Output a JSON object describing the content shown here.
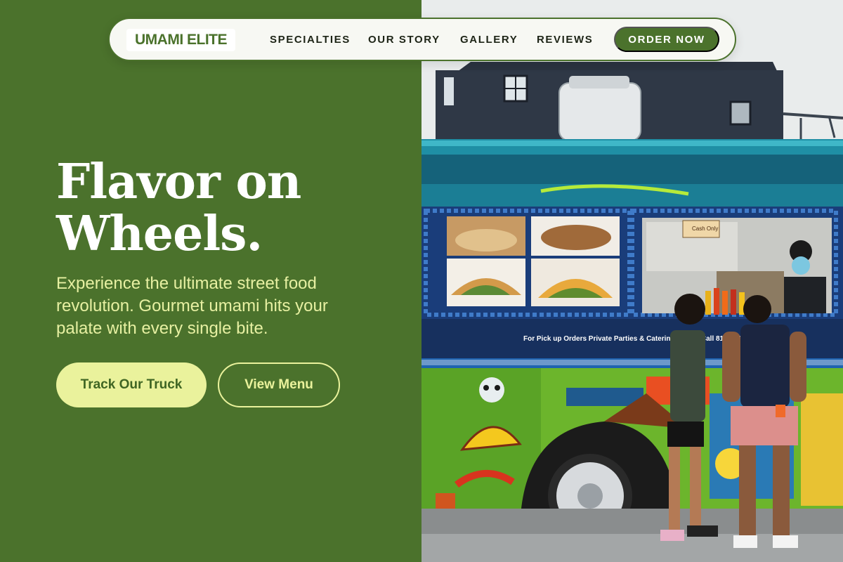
{
  "brand": {
    "logo_text": "UMAMI ELITE"
  },
  "nav": {
    "links": [
      "SPECIALTIES",
      "OUR STORY",
      "GALLERY",
      "REVIEWS"
    ],
    "cta_label": "ORDER NOW"
  },
  "hero": {
    "title_line1": "Flavor on",
    "title_line2": "Wheels.",
    "subtitle": "Experience the ultimate street food revolution. Gourmet umami hits your palate with every single bite.",
    "primary_button": "Track Our Truck",
    "secondary_button": "View Menu"
  },
  "photo": {
    "truck_sign": "For Pick up Orders Private Parties & Catering Please Call 819 9066",
    "menu_card": "Cash Only"
  },
  "colors": {
    "brand_green": "#4b722c",
    "accent_yellow": "#eaf29c",
    "text_light": "#e7f0a2",
    "white": "#ffffff"
  }
}
